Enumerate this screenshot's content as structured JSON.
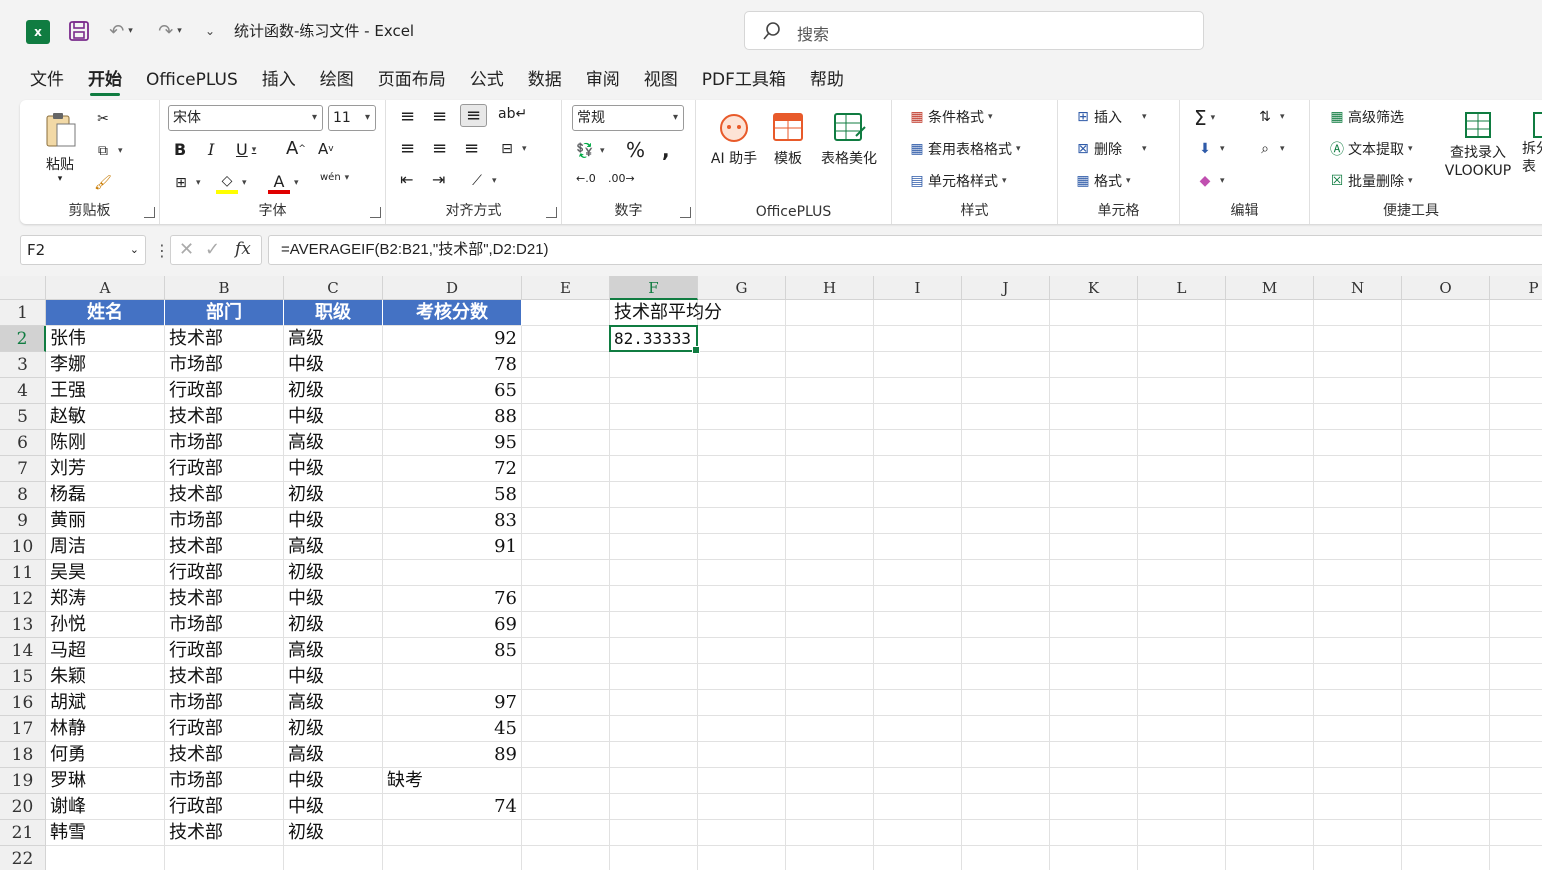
{
  "app": {
    "logo_letter": "x",
    "title": "统计函数-练习文件  -  Excel",
    "search_placeholder": "搜索"
  },
  "menu_tabs": [
    "文件",
    "开始",
    "OfficePLUS",
    "插入",
    "绘图",
    "页面布局",
    "公式",
    "数据",
    "审阅",
    "视图",
    "PDF工具箱",
    "帮助"
  ],
  "active_tab": "开始",
  "ribbon": {
    "clipboard": {
      "label": "剪贴板",
      "paste": "粘贴"
    },
    "font": {
      "label": "字体",
      "font_name": "宋体",
      "font_size": "11",
      "pinyin": "wén"
    },
    "alignment": {
      "label": "对齐方式"
    },
    "number": {
      "label": "数字",
      "format": "常规"
    },
    "officeplus": {
      "label": "OfficePLUS",
      "ai": "AI 助手",
      "template": "模板",
      "beautify": "表格美化"
    },
    "styles": {
      "label": "样式",
      "conditional": "条件格式",
      "table_format": "套用表格格式",
      "cell_style": "单元格样式"
    },
    "cells": {
      "label": "单元格",
      "insert": "插入",
      "delete": "删除",
      "format": "格式"
    },
    "editing": {
      "label": "编辑"
    },
    "tools": {
      "label": "便捷工具",
      "adv_filter": "高级筛选",
      "text_extract": "文本提取",
      "batch_delete": "批量删除",
      "lookup_line1": "查找录入",
      "lookup_line2": "VLOOKUP",
      "split_line1": "拆分",
      "split_line2": "表"
    }
  },
  "formula_bar": {
    "name_box": "F2",
    "formula": "=AVERAGEIF(B2:B21,\"技术部\",D2:D21)"
  },
  "sheet": {
    "columns": [
      "A",
      "B",
      "C",
      "D",
      "E",
      "F",
      "G",
      "H",
      "I",
      "J",
      "K",
      "L",
      "M",
      "N",
      "O",
      "P"
    ],
    "selected_column": "F",
    "selected_row": 2,
    "rows": [
      "1",
      "2",
      "3",
      "4",
      "5",
      "6",
      "7",
      "8",
      "9",
      "10",
      "11",
      "12",
      "13",
      "14",
      "15",
      "16",
      "17",
      "18",
      "19",
      "20",
      "21",
      "22"
    ],
    "header": [
      "姓名",
      "部门",
      "职级",
      "考核分数"
    ],
    "data": [
      [
        "张伟",
        "技术部",
        "高级",
        "92"
      ],
      [
        "李娜",
        "市场部",
        "中级",
        "78"
      ],
      [
        "王强",
        "行政部",
        "初级",
        "65"
      ],
      [
        "赵敏",
        "技术部",
        "中级",
        "88"
      ],
      [
        "陈刚",
        "市场部",
        "高级",
        "95"
      ],
      [
        "刘芳",
        "行政部",
        "中级",
        "72"
      ],
      [
        "杨磊",
        "技术部",
        "初级",
        "58"
      ],
      [
        "黄丽",
        "市场部",
        "中级",
        "83"
      ],
      [
        "周洁",
        "技术部",
        "高级",
        "91"
      ],
      [
        "吴昊",
        "行政部",
        "初级",
        ""
      ],
      [
        "郑涛",
        "技术部",
        "中级",
        "76"
      ],
      [
        "孙悦",
        "市场部",
        "初级",
        "69"
      ],
      [
        "马超",
        "行政部",
        "高级",
        "85"
      ],
      [
        "朱颖",
        "技术部",
        "中级",
        ""
      ],
      [
        "胡斌",
        "市场部",
        "高级",
        "97"
      ],
      [
        "林静",
        "行政部",
        "初级",
        "45"
      ],
      [
        "何勇",
        "技术部",
        "高级",
        "89"
      ],
      [
        "罗琳",
        "市场部",
        "中级",
        "缺考"
      ],
      [
        "谢峰",
        "行政部",
        "中级",
        "74"
      ],
      [
        "韩雪",
        "技术部",
        "初级",
        ""
      ]
    ],
    "f1": "技术部平均分",
    "f2": "82.33333"
  },
  "colors": {
    "accent": "#107c41",
    "table_header": "#4472c4"
  }
}
